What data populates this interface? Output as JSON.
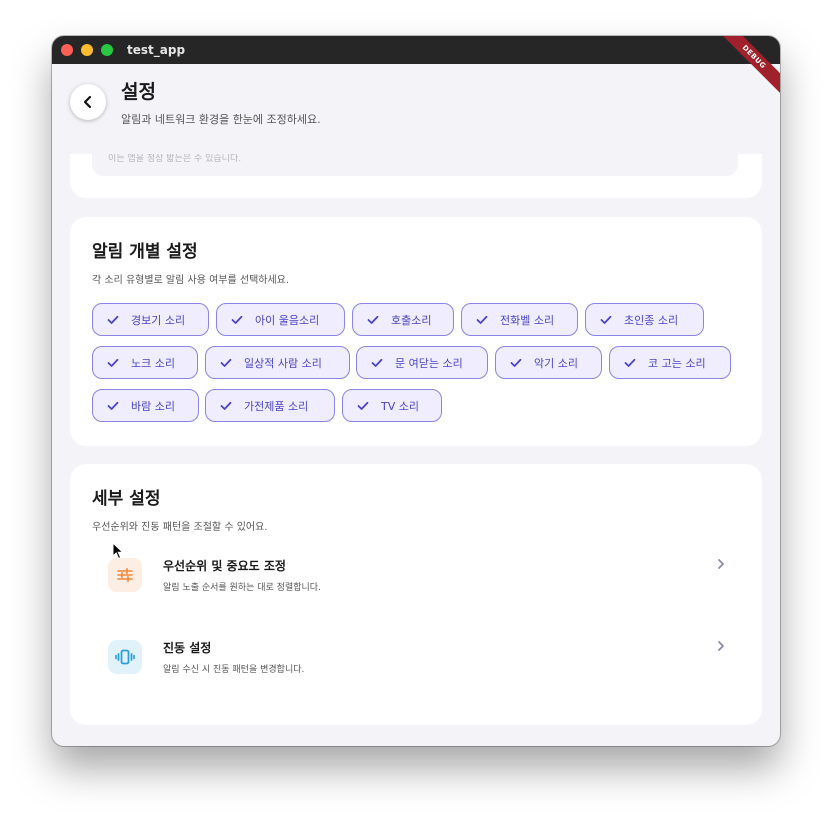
{
  "window": {
    "title": "test_app"
  },
  "appbar": {
    "title": "설정",
    "subtitle": "알림과 네트워크 환경을 한눈에 조정하세요."
  },
  "debug_banner": "DEBUG",
  "top_card": {
    "faded_text": "이는 앱을 정상 밟는은 수 있습니다."
  },
  "alert_section": {
    "title": "알림 개별 설정",
    "subtitle": "각 소리 유형별로 알림 사용 여부를 선택하세요.",
    "chips": [
      {
        "label": "경보기 소리",
        "selected": true
      },
      {
        "label": "아이 울음소리",
        "selected": true
      },
      {
        "label": "호출소리",
        "selected": true
      },
      {
        "label": "전화벨 소리",
        "selected": true
      },
      {
        "label": "초인종 소리",
        "selected": true
      },
      {
        "label": "노크 소리",
        "selected": true
      },
      {
        "label": "일상적 사람 소리",
        "selected": true
      },
      {
        "label": "문 여닫는 소리",
        "selected": true
      },
      {
        "label": "악기 소리",
        "selected": true
      },
      {
        "label": "코 고는 소리",
        "selected": true
      },
      {
        "label": "바람 소리",
        "selected": true
      },
      {
        "label": "가전제품 소리",
        "selected": true
      },
      {
        "label": "TV 소리",
        "selected": true
      }
    ]
  },
  "detail_section": {
    "title": "세부 설정",
    "subtitle": "우선순위와 진동 패턴을 조절할 수 있어요.",
    "items": [
      {
        "title": "우선순위 및 중요도 조정",
        "desc": "알림 노출 순서를 원하는 대로 정렬합니다.",
        "icon": "sliders-icon"
      },
      {
        "title": "진동 설정",
        "desc": "알림 수신 시 진동 패턴을 변경합니다.",
        "icon": "vibration-icon"
      }
    ]
  },
  "colors": {
    "accent": "#4b44c6",
    "chip_bg": "#efedff",
    "chip_border": "#8b84e6",
    "priority_icon_bg": "#fdeee3",
    "priority_icon": "#f0863a",
    "vibration_icon_bg": "#e2f2fb",
    "vibration_icon": "#2a9fd8"
  }
}
